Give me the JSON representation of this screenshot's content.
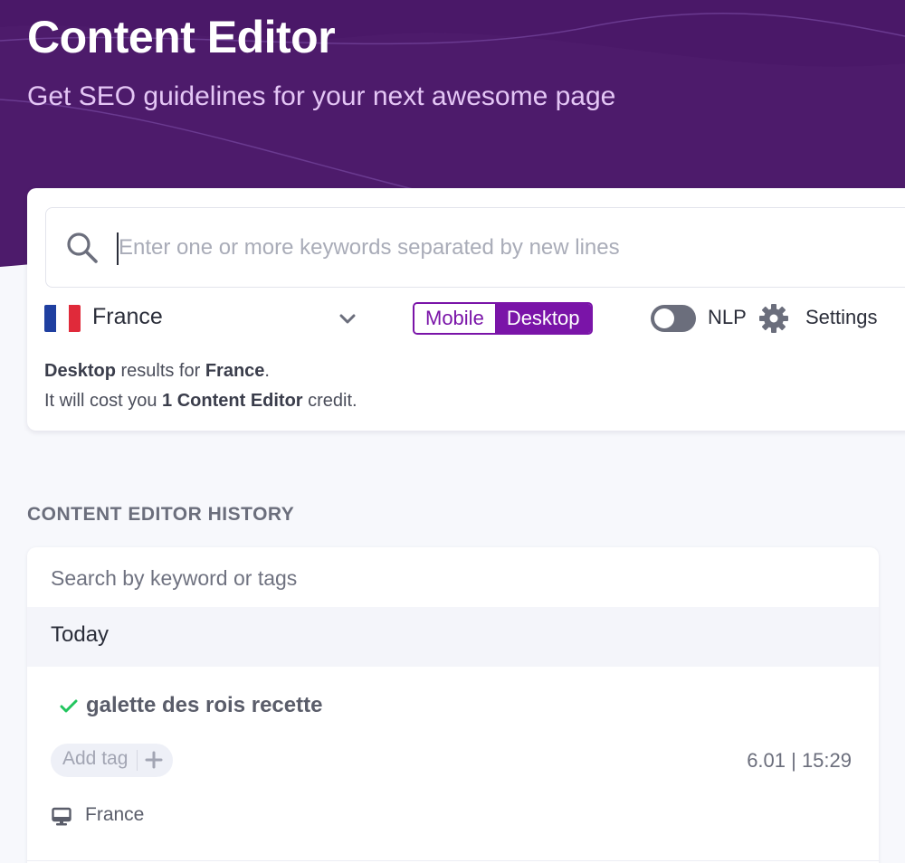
{
  "header": {
    "title": "Content Editor",
    "subtitle": "Get SEO guidelines for your next awesome page"
  },
  "search": {
    "placeholder": "Enter one or more keywords separated by new lines",
    "icon": "search-icon"
  },
  "location": {
    "country": "France",
    "flag_colors": [
      "#1f3fa0",
      "#ffffff",
      "#e02a3a"
    ]
  },
  "device": {
    "options": [
      "Mobile",
      "Desktop"
    ],
    "selected": "Desktop"
  },
  "nlp": {
    "label": "NLP",
    "enabled": false
  },
  "settings": {
    "label": "Settings",
    "icon": "gear-icon"
  },
  "summary": {
    "line1_device": "Desktop",
    "line1_text": " results for ",
    "line1_country": "France",
    "line1_end": ".",
    "line2_prefix": "It will cost you ",
    "line2_bold": "1 Content Editor",
    "line2_suffix": " credit."
  },
  "history": {
    "heading": "CONTENT EDITOR HISTORY",
    "search_placeholder": "Search by keyword or tags",
    "groups": [
      {
        "label": "Today",
        "entries": [
          {
            "keyword": "galette des rois recette",
            "status": "completed",
            "tag_placeholder": "Add tag",
            "datetime": "6.01 | 15:29",
            "device_icon": "monitor-icon",
            "country": "France"
          }
        ]
      }
    ]
  },
  "colors": {
    "hero_bg": "#4d1b6b",
    "accent": "#7a14a8",
    "success": "#22c55e"
  }
}
